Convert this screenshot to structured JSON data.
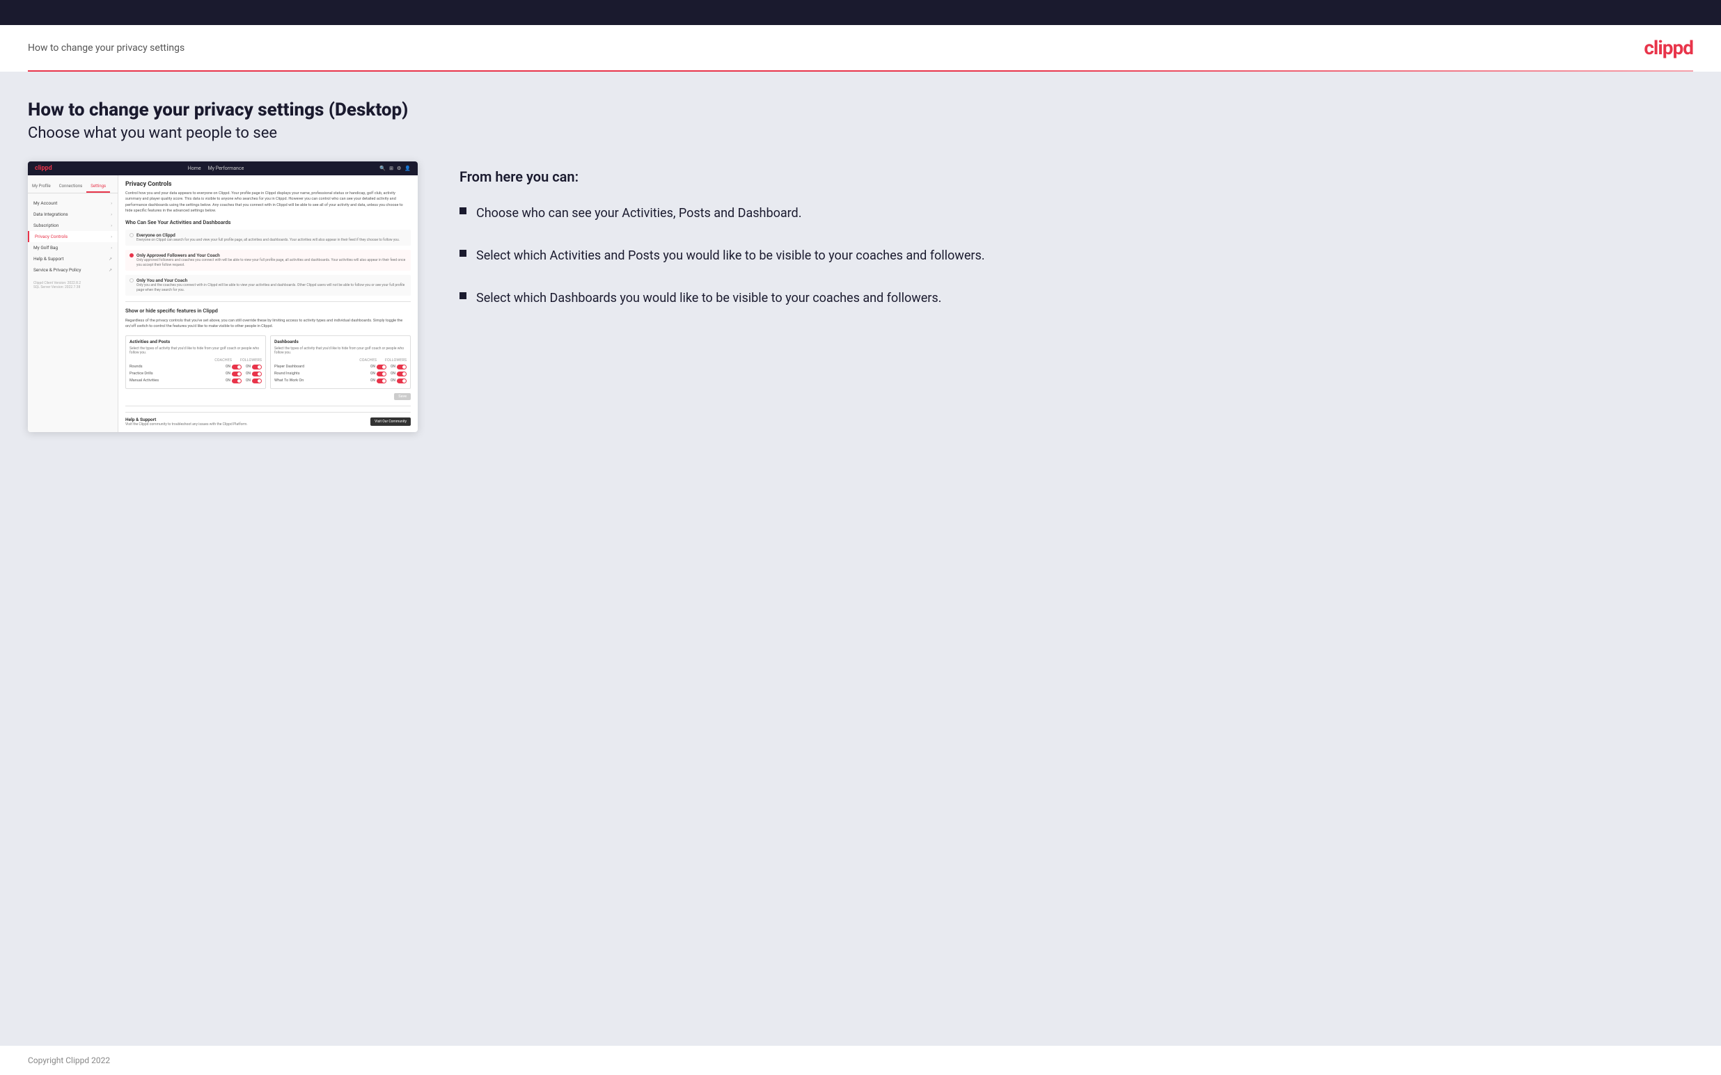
{
  "topbar": {},
  "header": {
    "page_title": "How to change your privacy settings",
    "logo": "clippd"
  },
  "main": {
    "heading": "How to change your privacy settings (Desktop)",
    "subheading": "Choose what you want people to see",
    "info_panel": {
      "from_here_label": "From here you can:",
      "bullets": [
        "Choose who can see your Activities, Posts and Dashboard.",
        "Select which Activities and Posts you would like to be visible to your coaches and followers.",
        "Select which Dashboards you would like to be visible to your coaches and followers."
      ]
    }
  },
  "mockup": {
    "logo": "clippd",
    "nav": [
      "Home",
      "My Performance"
    ],
    "tabs": [
      "My Profile",
      "Connections",
      "Settings"
    ],
    "sidebar_items": [
      {
        "label": "My Account",
        "active": false
      },
      {
        "label": "Data Integrations",
        "active": false
      },
      {
        "label": "Subscription",
        "active": false
      },
      {
        "label": "Privacy Controls",
        "active": true
      },
      {
        "label": "My Golf Bag",
        "active": false
      },
      {
        "label": "Help & Support",
        "active": false
      },
      {
        "label": "Service & Privacy Policy",
        "active": false
      }
    ],
    "version": "Clippd Client Version: 2022.8.2\nSQL Server Version: 2022.7.38",
    "section_title": "Privacy Controls",
    "section_desc": "Control how you and your data appears to everyone on Clippd. Your profile page in Clippd displays your name, professional status or handicap, golf club, activity summary and player quality score. This data is visible to anyone who searches for you in Clippd. However you can control who can see your detailed activity and performance dashboards using the settings below. Any coaches that you connect with in Clippd will be able to see all of your activity and data, unless you choose to hide specific features in the advanced settings below.",
    "who_can_see_title": "Who Can See Your Activities and Dashboards",
    "radio_options": [
      {
        "label": "Everyone on Clippd",
        "desc": "Everyone on Clippd can search for you and view your full profile page, all activities and dashboards. Your activities will also appear in their feed if they choose to follow you.",
        "selected": false
      },
      {
        "label": "Only Approved Followers and Your Coach",
        "desc": "Only approved followers and coaches you connect with will be able to view your full profile page, all activities and dashboards. Your activities will also appear in their feed once you accept their follow request.",
        "selected": true
      },
      {
        "label": "Only You and Your Coach",
        "desc": "Only you and the coaches you connect with in Clippd will be able to view your activities and dashboards. Other Clippd users will not be able to follow you or see your full profile page when they search for you.",
        "selected": false
      }
    ],
    "show_hide_title": "Show or hide specific features in Clippd",
    "show_hide_desc": "Regardless of the privacy controls that you've set above, you can still override these by limiting access to activity types and individual dashboards. Simply toggle the on/off switch to control the features you'd like to make visible to other people in Clippd.",
    "activities_posts": {
      "title": "Activities and Posts",
      "desc": "Select the types of activity that you'd like to hide from your golf coach or people who follow you.",
      "header": [
        "COACHES",
        "FOLLOWERS"
      ],
      "rows": [
        {
          "label": "Rounds",
          "coaches_on": true,
          "followers_on": true
        },
        {
          "label": "Practice Drills",
          "coaches_on": true,
          "followers_on": true
        },
        {
          "label": "Manual Activities",
          "coaches_on": true,
          "followers_on": true
        }
      ]
    },
    "dashboards": {
      "title": "Dashboards",
      "desc": "Select the types of activity that you'd like to hide from your golf coach or people who follow you.",
      "header": [
        "COACHES",
        "FOLLOWERS"
      ],
      "rows": [
        {
          "label": "Player Dashboard",
          "coaches_on": true,
          "followers_on": true
        },
        {
          "label": "Round Insights",
          "coaches_on": true,
          "followers_on": true
        },
        {
          "label": "What To Work On",
          "coaches_on": true,
          "followers_on": true
        }
      ]
    },
    "save_label": "Save",
    "help_title": "Help & Support",
    "help_desc": "Visit the Clippd community to troubleshoot any issues with the Clippd Platform.",
    "visit_btn": "Visit Our Community"
  },
  "footer": {
    "copyright": "Copyright Clippd 2022"
  }
}
